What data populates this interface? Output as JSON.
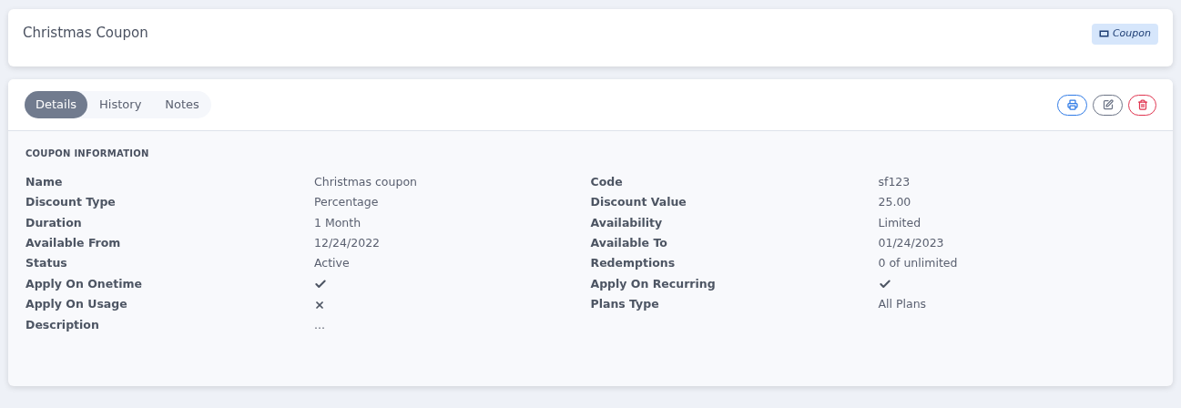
{
  "header": {
    "title": "Christmas Coupon",
    "badge": "Coupon"
  },
  "tabs": [
    {
      "label": "Details",
      "selected": true
    },
    {
      "label": "History",
      "selected": false
    },
    {
      "label": "Notes",
      "selected": false
    }
  ],
  "section_title": "COUPON INFORMATION",
  "columns": [
    {
      "fields": [
        {
          "label": "Name",
          "kind": "text",
          "value": "Christmas coupon"
        },
        {
          "label": "Discount Type",
          "kind": "text",
          "value": "Percentage"
        },
        {
          "label": "Duration",
          "kind": "text",
          "value": "1 Month"
        },
        {
          "label": "Available From",
          "kind": "text",
          "value": "12/24/2022"
        },
        {
          "label": "Status",
          "kind": "text",
          "value": "Active"
        },
        {
          "label": "Apply On Onetime",
          "kind": "flag",
          "checked": true
        },
        {
          "label": "Apply On Usage",
          "kind": "flag",
          "checked": false
        },
        {
          "label": "Description",
          "kind": "text",
          "value": "..."
        }
      ]
    },
    {
      "fields": [
        {
          "label": "Code",
          "kind": "text",
          "value": "sf123"
        },
        {
          "label": "Discount Value",
          "kind": "text",
          "value": "25.00"
        },
        {
          "label": "Availability",
          "kind": "text",
          "value": "Limited"
        },
        {
          "label": "Available To",
          "kind": "text",
          "value": "01/24/2023"
        },
        {
          "label": "Redemptions",
          "kind": "text",
          "value": "0 of unlimited"
        },
        {
          "label": "Apply On Recurring",
          "kind": "flag",
          "checked": true
        },
        {
          "label": "Plans Type",
          "kind": "text",
          "value": "All Plans"
        }
      ]
    }
  ]
}
